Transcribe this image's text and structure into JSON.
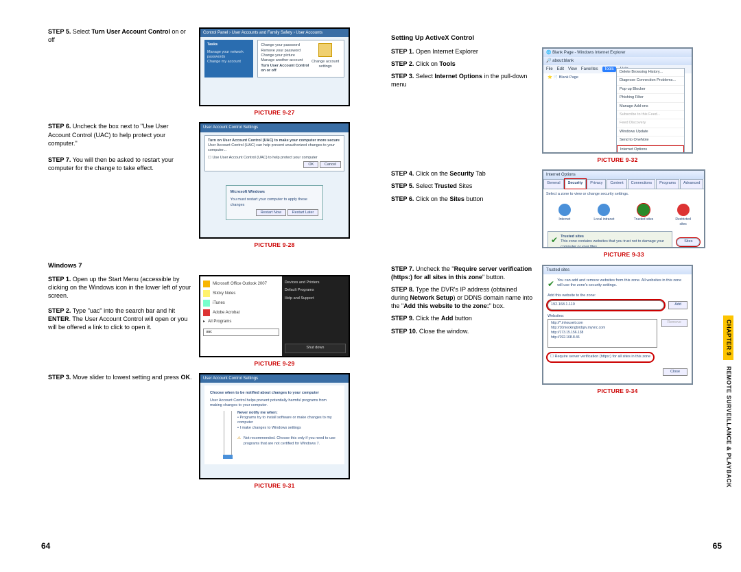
{
  "left": {
    "step5": {
      "prefix": "STEP 5.",
      "text": " Select Turn User Account Control on or off",
      "bold_inline": "Turn User Account Control"
    },
    "pic27": "PICTURE 9-27",
    "step6": {
      "prefix": "STEP 6.",
      "text": " Uncheck the box next to \"Use User Account Control (UAC) to help protect your computer.\""
    },
    "step7": {
      "prefix": "STEP 7.",
      "text": " You will then be asked to restart your computer for the change to take effect."
    },
    "pic28": "PICTURE 9-28",
    "win7_head": "Windows 7",
    "w7s1": {
      "prefix": "STEP 1.",
      "text": " Open up the Start Menu (accessible by clicking on the Windows icon in the lower left of your screen."
    },
    "w7s2": {
      "prefix": "STEP 2.",
      "text": " Type \"uac\" into the search bar and hit ENTER. The User Account Control will open or you will be offered a link to click to open it.",
      "bold_inline": "ENTER"
    },
    "w7s3": {
      "prefix": "STEP 3.",
      "text": " Move slider to lowest setting and press OK.",
      "bold_inline": "OK"
    },
    "pic29": "PICTURE 9-29",
    "pic31": "PICTURE 9-31"
  },
  "right": {
    "sec_head": "Setting Up ActiveX Control",
    "s1": {
      "prefix": "STEP 1.",
      "text": " Open Internet Explorer"
    },
    "s2": {
      "prefix": "STEP 2.",
      "text": " Click on Tools",
      "bold_inline": "Tools"
    },
    "s3": {
      "prefix": "STEP 3.",
      "text": " Select Internet Options in the pull-down menu",
      "bold_inline": "Internet Options"
    },
    "pic32": "PICTURE 9-32",
    "s4": {
      "prefix": "STEP 4.",
      "text": " Click on the Security Tab",
      "bold_inline": "Security"
    },
    "s5": {
      "prefix": "STEP 5.",
      "text": " Select Trusted Sites",
      "bold_inline": "Trusted"
    },
    "s6": {
      "prefix": "STEP 6.",
      "text": " Click on the Sites button",
      "bold_inline": "Sites"
    },
    "pic33": "PICTURE 9-33",
    "s7": {
      "prefix": "STEP 7.",
      "text": " Uncheck the \"Require server verification (https:) for all sites in this zone\" button."
    },
    "s8": {
      "prefix": "STEP 8.",
      "text": " Type the DVR's IP address (obtained during Network Setup) or DDNS domain name into the \"Add this website to the zone:\" box.",
      "bold_inline": "Network Setup"
    },
    "s9": {
      "prefix": "STEP 9.",
      "text": " Click the Add button",
      "bold_inline": "Add"
    },
    "s10": {
      "prefix": "STEP 10.",
      "text": " Close the window."
    },
    "pic34": "PICTURE 9-34"
  },
  "fig27": {
    "header": "Control Panel › User Accounts and Family Safety › User Accounts",
    "tasks": "Tasks",
    "links": [
      "Change your password",
      "Remove your password",
      "Change your picture",
      "Manage another account",
      "Turn User Account Control on or off"
    ],
    "right_label": "Change account settings"
  },
  "fig28": {
    "header": "User Account Control Settings",
    "top": "Turn on User Account Control (UAC) to make your computer more secure",
    "sub": "User Account Control (UAC) can help prevent unauthorized changes to your computer...",
    "chk": "Use User Account Control (UAC) to help protect your computer",
    "dialog_title": "Microsoft Windows",
    "dialog_msg": "You must restart your computer to apply these changes",
    "btn1": "Restart Now",
    "btn2": "Restart Later"
  },
  "fig29": {
    "left_items": [
      "Microsoft Office Outlook 2007",
      "Sticky Notes",
      "iTunes",
      "Adobe Acrobat",
      "All Programs"
    ],
    "search": "uac",
    "right_items": [
      "Devices and Printers",
      "Default Programs",
      "Help and Support"
    ],
    "shutdown": "Shut down"
  },
  "fig31": {
    "header": "User Account Control Settings",
    "title": "Choose when to be notified about changes to your computer",
    "sub": "User Account Control helps prevent potentially harmful programs from making changes to your computer.",
    "opt_head": "Never notify me when:",
    "opt1": "Programs try to install software or make changes to my computer",
    "opt2": "I make changes to Windows settings",
    "warn": "Not recommended. Choose this only if you need to use programs that are not certified for Windows 7."
  },
  "fig32": {
    "title": "Blank Page - Windows Internet Explorer",
    "addr": "about:blank",
    "menu": [
      "File",
      "Edit",
      "View",
      "Favorites",
      "Tools",
      "Help"
    ],
    "tab": "Blank Page",
    "drop": [
      "Delete Browsing History...",
      "Diagnose Connection Problems...",
      "Pop-up Blocker",
      "Phishing Filter",
      "Manage Add-ons",
      "Subscribe to this Feed...",
      "Feed Discovery",
      "Windows Update",
      "Send to OneNote",
      "Internet Options"
    ]
  },
  "fig33": {
    "title": "Internet Options",
    "tabs": [
      "General",
      "Security",
      "Privacy",
      "Content",
      "Connections",
      "Programs",
      "Advanced"
    ],
    "zone_msg": "Select a zone to view or change security settings.",
    "zones": [
      "Internet",
      "Local intranet",
      "Trusted sites",
      "Restricted sites"
    ],
    "trusted_head": "Trusted sites",
    "trusted_msg": "This zone contains websites that you trust not to damage your computer or your files.",
    "sites_btn": "Sites"
  },
  "fig34": {
    "title": "Trusted sites",
    "msg": "You can add and remove websites from this zone. All websites in this zone will use the zone's security settings.",
    "add_lbl": "Add this website to the zone:",
    "input_val": "192.168.1.110",
    "add_btn": "Add",
    "web_lbl": "Websites:",
    "websites": [
      "http://*.inhouseit.com",
      "http://10mockingbirdqsv.myvnc.com",
      "http://173.15.156.138",
      "http://192.168.8.46"
    ],
    "remove_btn": "Remove",
    "req": "Require server verification (https:) for all sites in this zone",
    "close_btn": "Close"
  },
  "page_left_num": "64",
  "page_right_num": "65",
  "side_tab": {
    "chapter": "CHAPTER 9",
    "title": " REMOTE SURVEILLANCE & PLAYBACK"
  }
}
